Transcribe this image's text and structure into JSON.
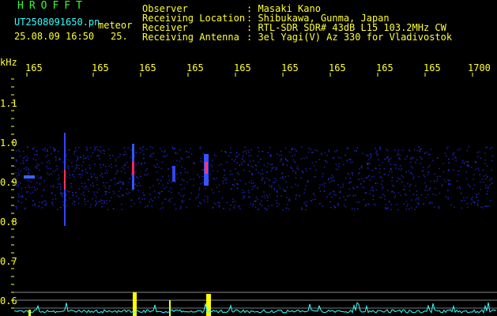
{
  "header": {
    "brand": "HROFFT",
    "filename": "UT2508091650.pn",
    "event_label": "meteor",
    "date_time": "25.08.09 16:50",
    "short_code": "25.",
    "observer_key": "Observer",
    "observer_val": ": Masaki Kano",
    "location_key": "Receiving Location",
    "location_val": ": Shibukawa, Gunma, Japan",
    "receiver_key": "Receiver",
    "receiver_val": ": RTL-SDR SDR# 43dB L15 103.2MHz CW",
    "antenna_key": "Receiving Antenna",
    "antenna_val": ": 3el Yagi(V) Az 330 for Vladivostok"
  },
  "axis": {
    "unit": "kHz",
    "x_ticks": [
      "165",
      "165",
      "165",
      "165",
      "165",
      "165",
      "165",
      "165",
      "165",
      "1700"
    ],
    "y_ticks": [
      "1.1",
      "1.0",
      "0.9",
      "0.8",
      "0.7",
      "0.6"
    ]
  },
  "colors": {
    "background": "#000000",
    "text": "#ffff33",
    "brand": "#33ff33",
    "noise": "#1a22cc",
    "trace": "#33ffff",
    "bar": "#ffff00"
  }
}
